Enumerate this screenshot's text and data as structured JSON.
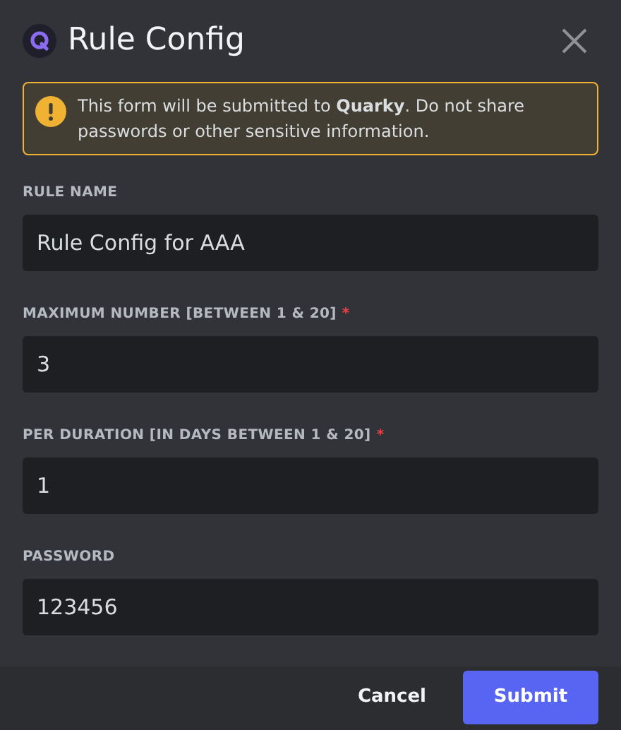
{
  "dialog": {
    "title": "Rule Config",
    "notice": "This form will be submitted to **Quarky**. Do not share passwords or other sensitive information.",
    "fields": [
      {
        "label": "RULE NAME",
        "required": false,
        "value": "Rule Config for AAA"
      },
      {
        "label": "MAXIMUM NUMBER [BETWEEN 1 & 20]",
        "required": true,
        "value": "3"
      },
      {
        "label": "PER DURATION [IN DAYS BETWEEN 1 & 20]",
        "required": true,
        "value": "1"
      },
      {
        "label": "PASSWORD",
        "required": false,
        "value": "123456"
      }
    ],
    "required_mark": "*",
    "buttons": [
      {
        "label": "Cancel",
        "kind": "link"
      },
      {
        "label": "Submit",
        "kind": "primary"
      }
    ]
  }
}
